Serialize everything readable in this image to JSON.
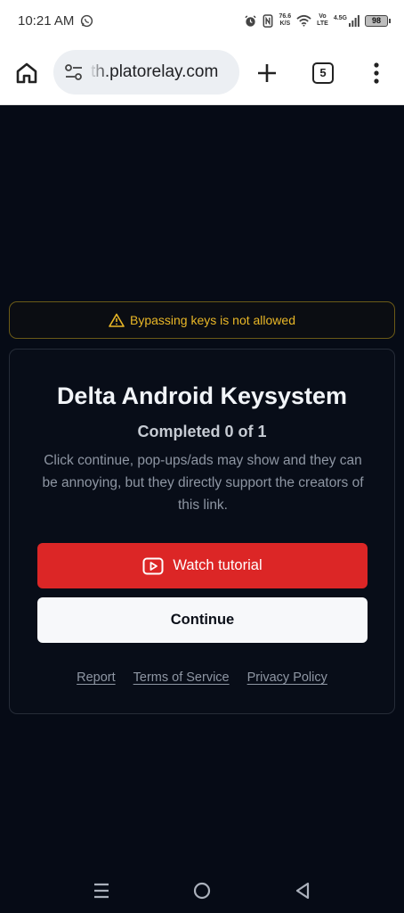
{
  "status_bar": {
    "time": "10:21 AM",
    "speed_value": "76.6",
    "speed_unit": "K/S",
    "volte_top": "Vo",
    "volte_bottom": "LTE",
    "network": "4.5G",
    "battery": "98"
  },
  "browser": {
    "url": "th.platorelay.com",
    "tab_count": "5"
  },
  "warning": {
    "text": "Bypassing keys is not allowed",
    "color": "#e9b727"
  },
  "card": {
    "title": "Delta Android Keysystem",
    "progress": "Completed 0 of 1",
    "description": "Click continue, pop-ups/ads may show and they can be annoying, but they directly support the creators of this link.",
    "watch_label": "Watch tutorial",
    "continue_label": "Continue",
    "accent": "#dc2626"
  },
  "footer": {
    "report": "Report",
    "terms": "Terms of Service",
    "privacy": "Privacy Policy"
  },
  "icons": {
    "status": [
      "whatsapp-icon",
      "alarm-icon",
      "nfc-icon",
      "wifi-icon",
      "signal-icon",
      "battery-icon"
    ],
    "browser": [
      "home-icon",
      "site-settings-icon",
      "plus-icon",
      "tabs-icon",
      "more-vert-icon"
    ],
    "nav": [
      "recents-icon",
      "home-circle-icon",
      "back-icon"
    ]
  }
}
